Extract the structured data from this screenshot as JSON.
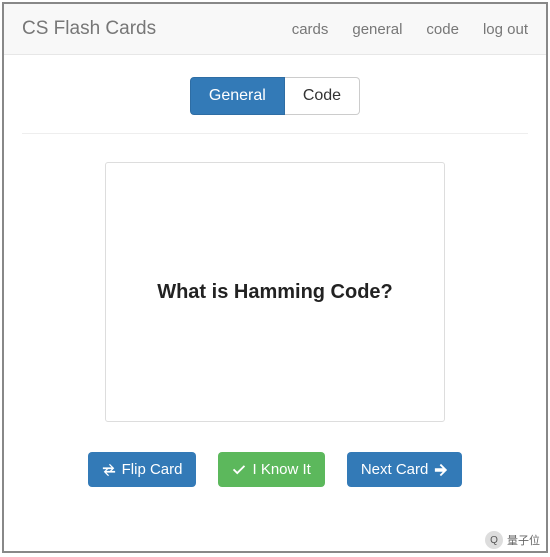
{
  "header": {
    "brand": "CS Flash Cards",
    "links": [
      "cards",
      "general",
      "code",
      "log out"
    ]
  },
  "tabs": {
    "active": "General",
    "inactive": "Code"
  },
  "card": {
    "question": "What is Hamming Code?"
  },
  "buttons": {
    "flip": "Flip Card",
    "know": "I Know It",
    "next": "Next Card"
  },
  "watermark": {
    "text": "量子位"
  }
}
